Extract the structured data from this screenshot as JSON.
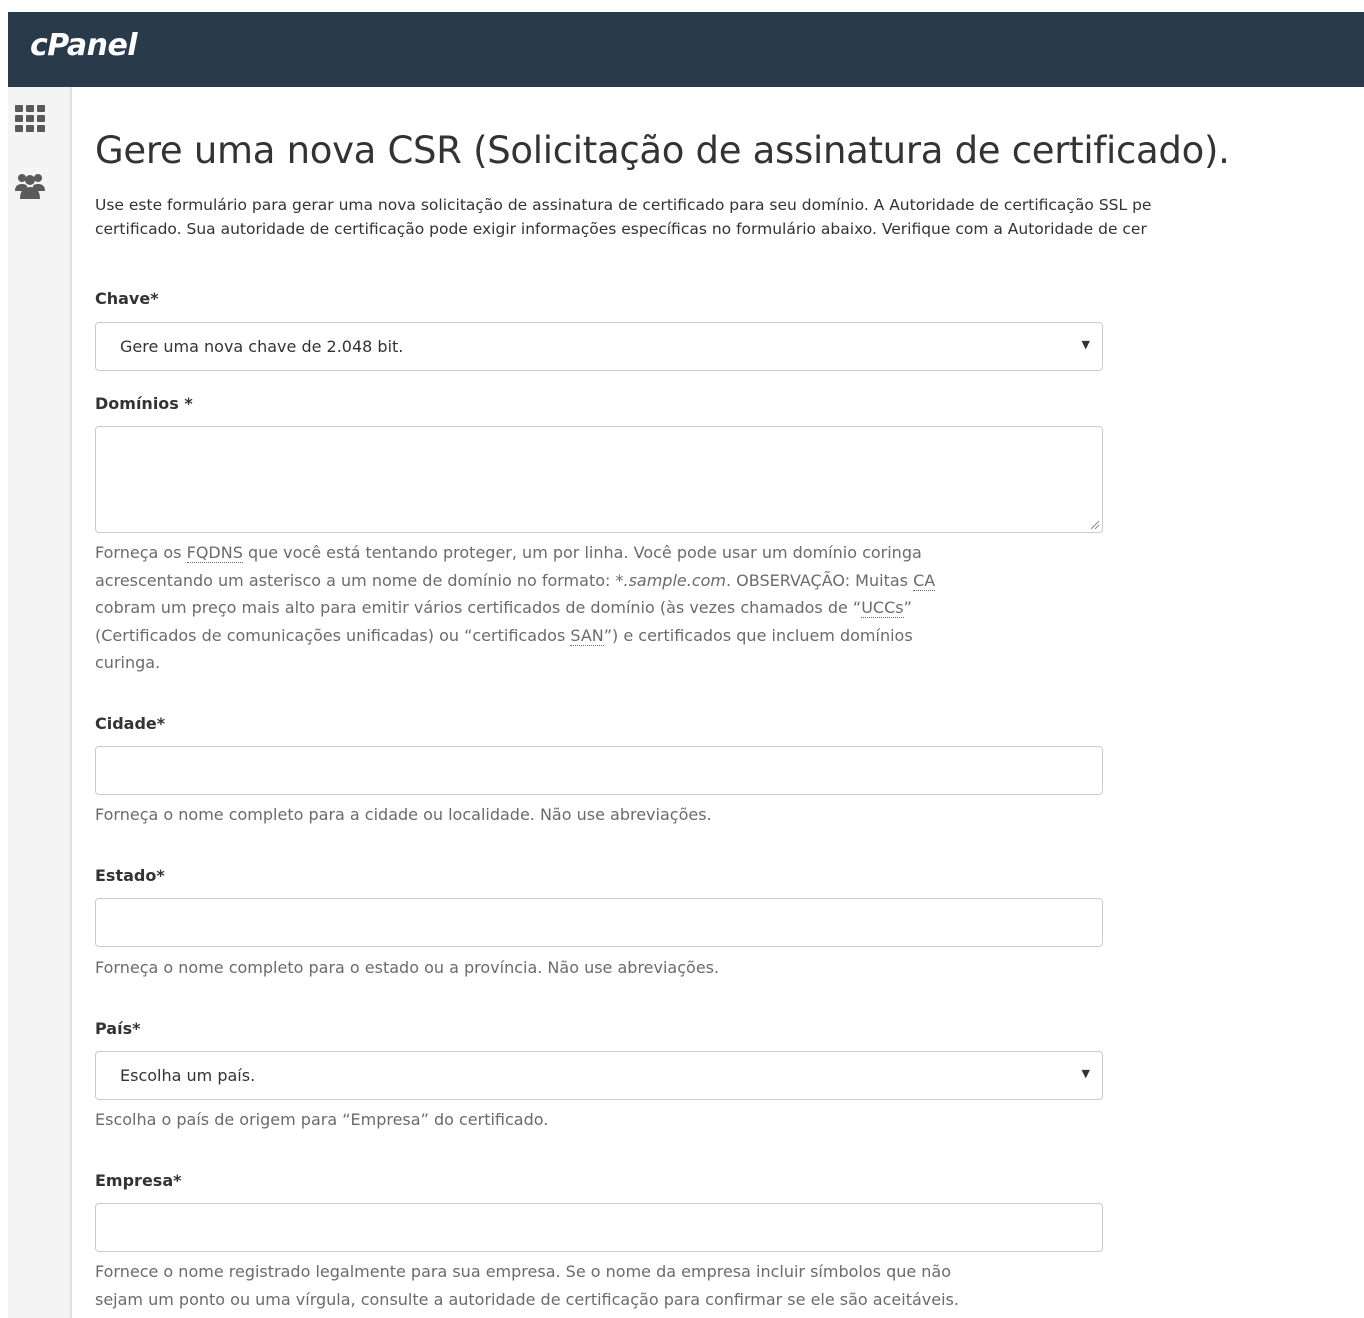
{
  "header": {
    "logo": "cPanel"
  },
  "sidebar": {
    "items": [
      {
        "icon": "grid-icon"
      },
      {
        "icon": "users-icon"
      }
    ]
  },
  "main": {
    "title": "Gere uma nova CSR (Solicitação de assinatura de certificado).",
    "intro_line1": "Use este formulário para gerar uma nova solicitação de assinatura de certificado para seu domínio. A Autoridade de certificação SSL pe",
    "intro_line2": "certificado. Sua autoridade de certificação pode exigir informações específicas no formulário abaixo. Verifique com a Autoridade de cer"
  },
  "form": {
    "key": {
      "label": "Chave*",
      "selected": "Gere uma nova chave de 2.048 bit."
    },
    "domains": {
      "label": "Domínios *",
      "value": "",
      "help": {
        "l1_a": "Forneça os ",
        "l1_abbr": "FQDNS",
        "l1_b": " que você está tentando proteger, um por linha. Você pode usar um domínio coringa",
        "l2_a": "acrescentando um asterisco a um nome de domínio no formato: ",
        "l2_em": "*.sample.com",
        "l2_b": ". OBSERVAÇÃO: Muitas ",
        "l2_abbr": "CA",
        "l3_a": "cobram um preço mais alto para emitir vários certificados de domínio (às vezes chamados de “",
        "l3_abbr": "UCCs",
        "l3_b": "”",
        "l4_a": "(Certificados de comunicações unificadas) ou “certificados ",
        "l4_abbr": "SAN",
        "l4_b": "”) e certificados que incluem domínios",
        "l5": "curinga."
      }
    },
    "city": {
      "label": "Cidade*",
      "value": "",
      "help": "Forneça o nome completo para a cidade ou localidade. Não use abreviações."
    },
    "state": {
      "label": "Estado*",
      "value": "",
      "help": "Forneça o nome completo para o estado ou a província. Não use abreviações."
    },
    "country": {
      "label": "País*",
      "selected": "Escolha um país.",
      "help": "Escolha o país de origem para “Empresa” do certificado."
    },
    "company": {
      "label": "Empresa*",
      "value": "",
      "help_line1": "Fornece o nome registrado legalmente para sua empresa. Se o nome da empresa incluir símbolos que não",
      "help_line2": "sejam um ponto ou uma vírgula, consulte a autoridade de certificação para confirmar se ele são aceitáveis."
    }
  },
  "colors": {
    "topbar": "#293a4a",
    "sidebar": "#f4f4f4",
    "icon": "#5a5a5a",
    "help_text": "#6b6b6b",
    "border": "#cccccc"
  }
}
